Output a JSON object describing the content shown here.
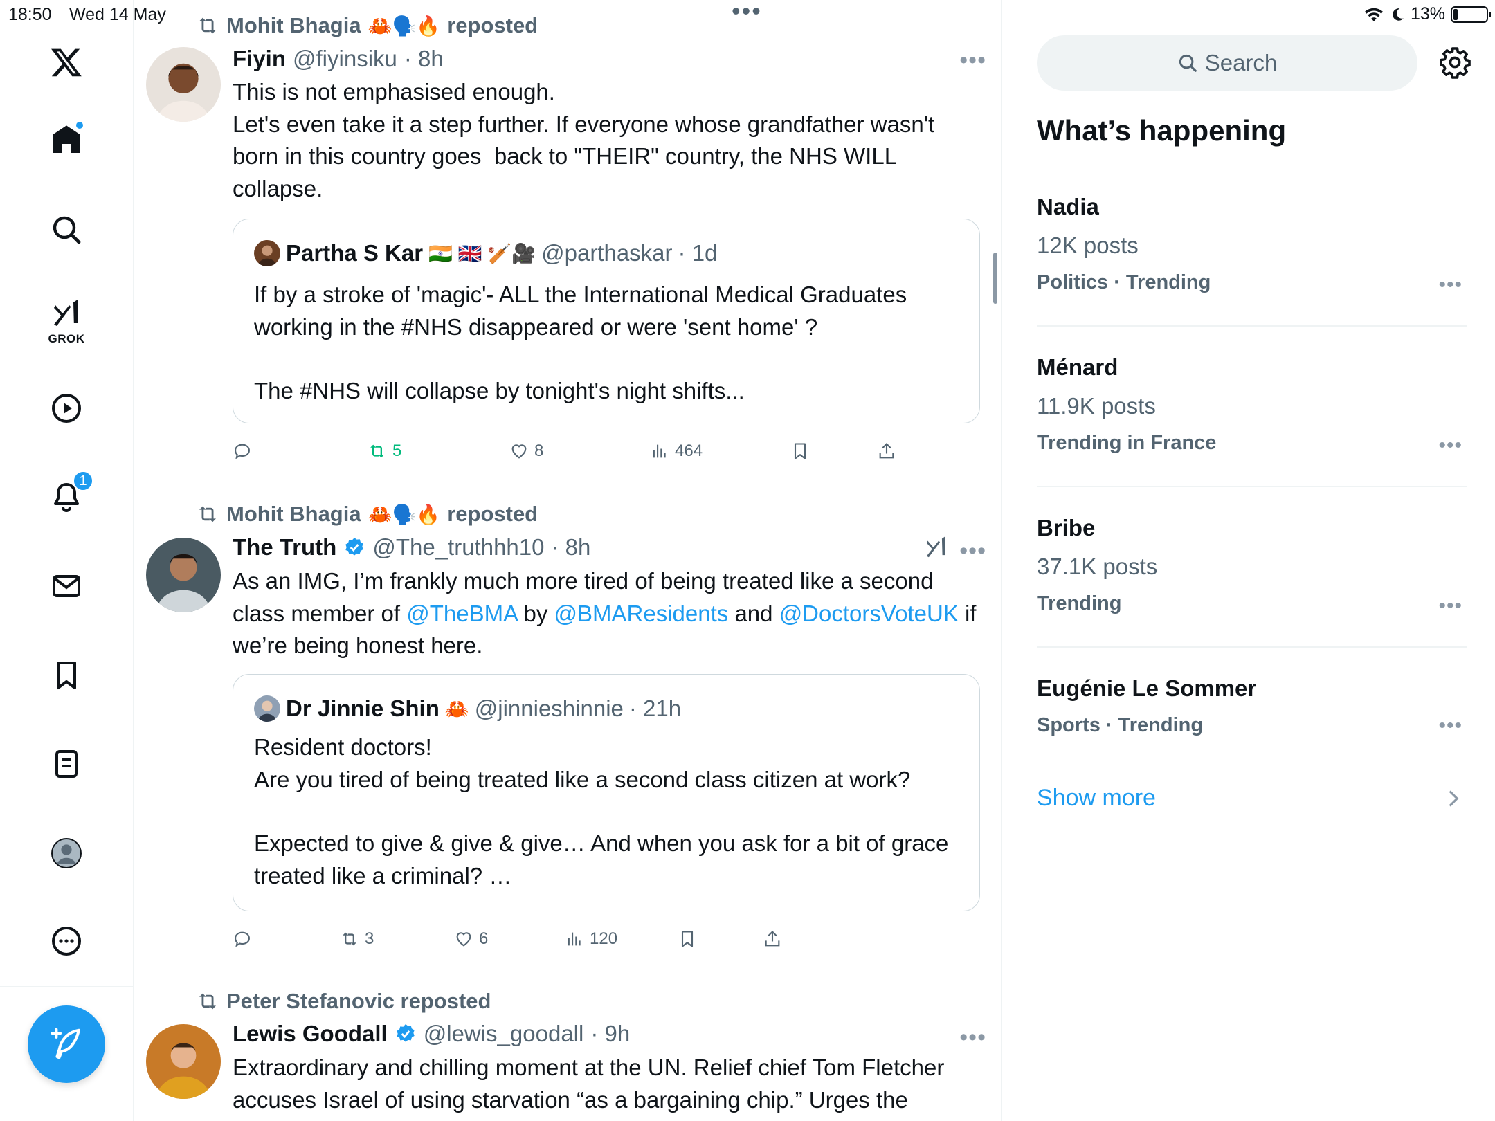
{
  "status_bar": {
    "time": "18:50",
    "date": "Wed 14 May",
    "battery": "13%",
    "battery_level": 0.13
  },
  "nav": {
    "items": [
      {
        "name": "x-logo",
        "icon": "x-logo-icon"
      },
      {
        "name": "home",
        "icon": "home-icon",
        "has_dot": true
      },
      {
        "name": "explore",
        "icon": "search-icon"
      },
      {
        "name": "grok",
        "icon": "grok-icon",
        "label": "GROK"
      },
      {
        "name": "video",
        "icon": "play-icon"
      },
      {
        "name": "notifications",
        "icon": "bell-icon",
        "badge": "1"
      },
      {
        "name": "messages",
        "icon": "mail-icon"
      },
      {
        "name": "bookmarks",
        "icon": "bookmark-icon"
      },
      {
        "name": "lists",
        "icon": "list-icon"
      },
      {
        "name": "profile",
        "icon": "profile-avatar-icon"
      },
      {
        "name": "more",
        "icon": "more-circle-icon"
      }
    ],
    "compose_icon": "compose-icon"
  },
  "timeline": {
    "tweets": [
      {
        "repost_by": "Mohit Bhagia",
        "repost_emojis": "🦀🗣️🔥",
        "repost_suffix": "reposted",
        "name": "Fiyin",
        "handle": "@fiyinsiku",
        "time": "· 8h",
        "text_lines": [
          "This is not emphasised enough.",
          "Let's even take it a step further. If everyone whose grandfather wasn't born in this country goes  back to \"THEIR\" country, the NHS WILL collapse."
        ],
        "quote": {
          "name": "Partha S Kar",
          "emojis": "🇮🇳 🇬🇧 🏏🎥",
          "handle": "@parthaskar",
          "time": "· 1d",
          "text_lines": [
            "If by a stroke of 'magic'- ALL the International Medical Graduates working in the #NHS disappeared or were 'sent home' ?",
            "",
            "The #NHS will collapse by tonight's night shifts..."
          ]
        },
        "actions": {
          "reply": "",
          "repost": "5",
          "like": "8",
          "views": "464"
        }
      },
      {
        "repost_by": "Mohit Bhagia",
        "repost_emojis": "🦀🗣️🔥",
        "repost_suffix": "reposted",
        "name": "The Truth",
        "handle": "@The_truthhh10",
        "time": "· 8h",
        "verified": true,
        "text_parts": {
          "a": "As an IMG, I’m frankly much more tired of being treated like a second class member of ",
          "m1": "@TheBMA",
          "b": " by ",
          "m2": "@BMAResidents",
          "c": " and ",
          "m3": "@DoctorsVoteUK",
          "d": " if we’re being honest here."
        },
        "quote": {
          "name": "Dr Jinnie Shin",
          "emojis": "🦀",
          "handle": "@jinnieshinnie",
          "time": "· 21h",
          "text_lines": [
            "Resident doctors!",
            "Are you tired of being treated like a second class citizen at work?",
            "",
            "Expected to give & give & give… And when you ask for a bit of grace treated like a criminal? …"
          ]
        },
        "actions": {
          "reply": "",
          "repost": "3",
          "like": "6",
          "views": "120"
        }
      },
      {
        "repost_by": "Peter Stefanovic reposted",
        "name": "Lewis Goodall",
        "handle": "@lewis_goodall",
        "time": "· 9h",
        "verified": true,
        "text": "Extraordinary and chilling moment at the UN. Relief chief Tom Fletcher accuses Israel of using starvation “as a bargaining chip.” Urges the"
      }
    ]
  },
  "sidebar": {
    "search_placeholder": "Search",
    "title": "What’s happening",
    "trends": [
      {
        "name": "Nadia",
        "count": "12K posts",
        "context": "Politics · Trending"
      },
      {
        "name": "Ménard",
        "count": "11.9K posts",
        "context": "Trending in France"
      },
      {
        "name": "Bribe",
        "count": "37.1K posts",
        "context": "Trending"
      },
      {
        "name": "Eugénie Le Sommer",
        "count": "",
        "context": "Sports · Trending"
      }
    ],
    "show_more": "Show more"
  },
  "colors": {
    "accent": "#1d9bf0",
    "text": "#0f1419",
    "secondary": "#536471",
    "repost_green": "#00ba7c",
    "border": "#cfd9de"
  }
}
